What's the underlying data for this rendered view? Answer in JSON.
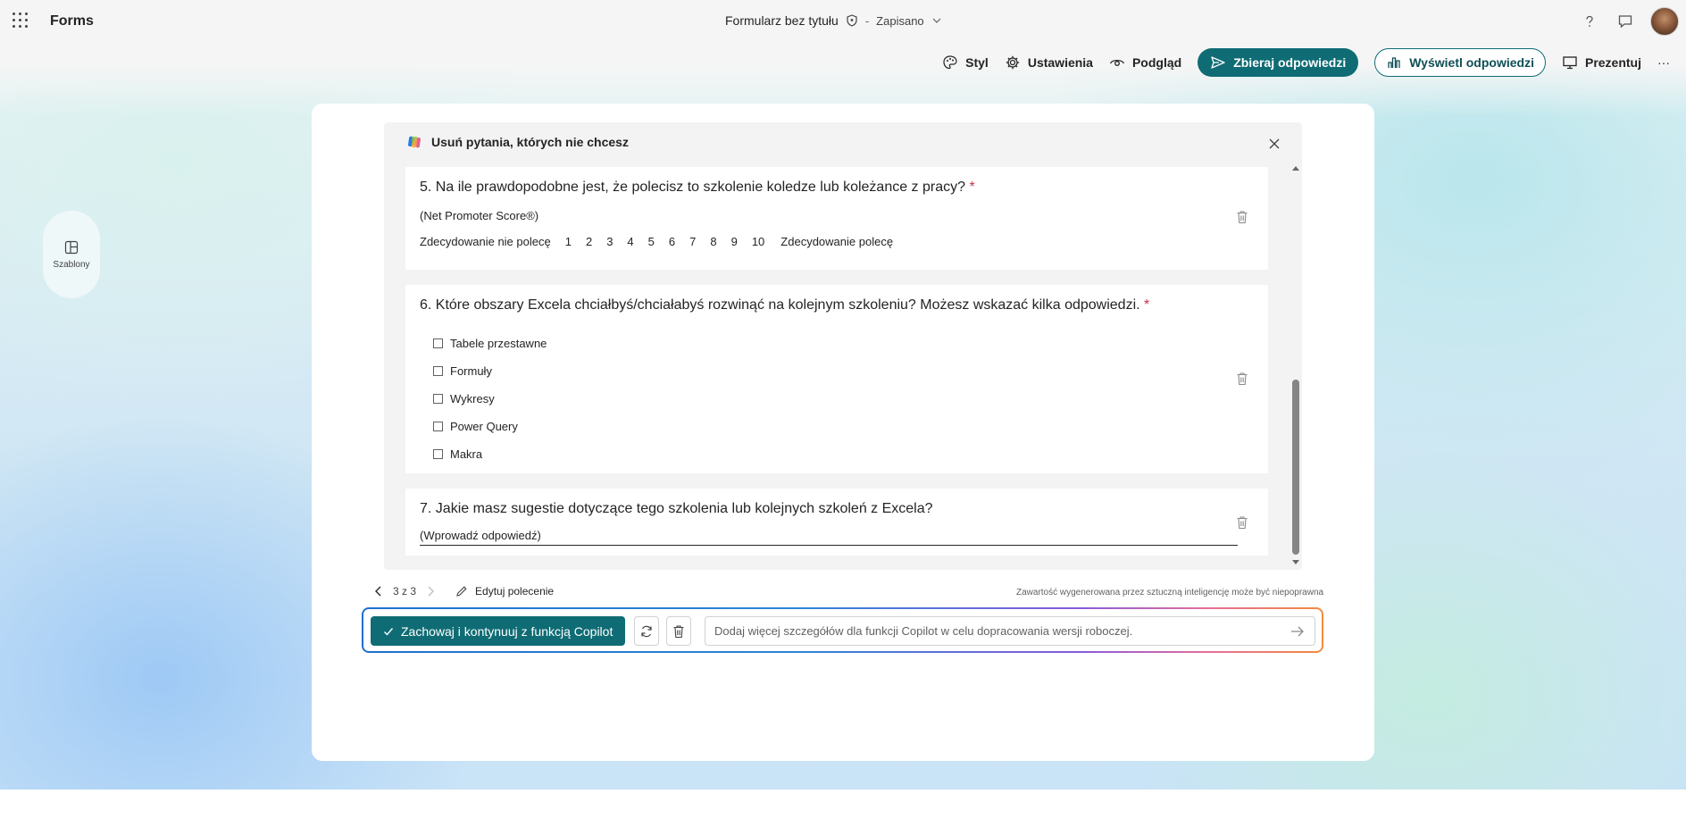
{
  "app": {
    "name": "Forms"
  },
  "document": {
    "title": "Formularz bez tytułu",
    "separator": "-",
    "save_status": "Zapisano"
  },
  "header": {
    "help_icon": "question-icon",
    "feedback_icon": "chat-icon"
  },
  "toolbar": {
    "style_label": "Styl",
    "settings_label": "Ustawienia",
    "preview_label": "Podgląd",
    "collect_label": "Zbieraj odpowiedzi",
    "view_responses_label": "Wyświetl odpowiedzi",
    "present_label": "Prezentuj",
    "more_label": "···"
  },
  "rail": {
    "templates_label": "Szablony"
  },
  "panel": {
    "heading": "Usuń pytania, których nie chcesz",
    "questions": [
      {
        "title": "5. Na ile prawdopodobne jest, że polecisz to szkolenie koledze lub koleżance z pracy?",
        "required_mark": "*",
        "subtitle": "(Net Promoter Score®)",
        "scale_left": "Zdecydowanie nie polecę",
        "scale": [
          "1",
          "2",
          "3",
          "4",
          "5",
          "6",
          "7",
          "8",
          "9",
          "10"
        ],
        "scale_right": "Zdecydowanie polecę"
      },
      {
        "title": "6. Które obszary Excela chciałbyś/chciałabyś rozwinąć na kolejnym szkoleniu? Możesz wskazać kilka odpowiedzi.",
        "required_mark": "*",
        "options": [
          "Tabele przestawne",
          "Formuły",
          "Wykresy",
          "Power Query",
          "Makra"
        ]
      },
      {
        "title": "7. Jakie masz sugestie dotyczące tego szkolenia lub kolejnych szkoleń z Excela?",
        "answer_placeholder": "(Wprowadź odpowiedź)"
      }
    ]
  },
  "pager": {
    "text": "3 z 3",
    "edit_prompt_label": "Edytuj polecenie"
  },
  "disclaimer": "Zawartość wygenerowana przez sztuczną inteligencję może być niepoprawna",
  "copilot": {
    "keep_label": "Zachowaj i kontynuuj z funkcją Copilot",
    "input_placeholder": "Dodaj więcej szczegółów dla funkcji Copilot w celu dopracowania wersji roboczej."
  },
  "colors": {
    "accent": "#0f6c74",
    "required": "#c4314b"
  }
}
